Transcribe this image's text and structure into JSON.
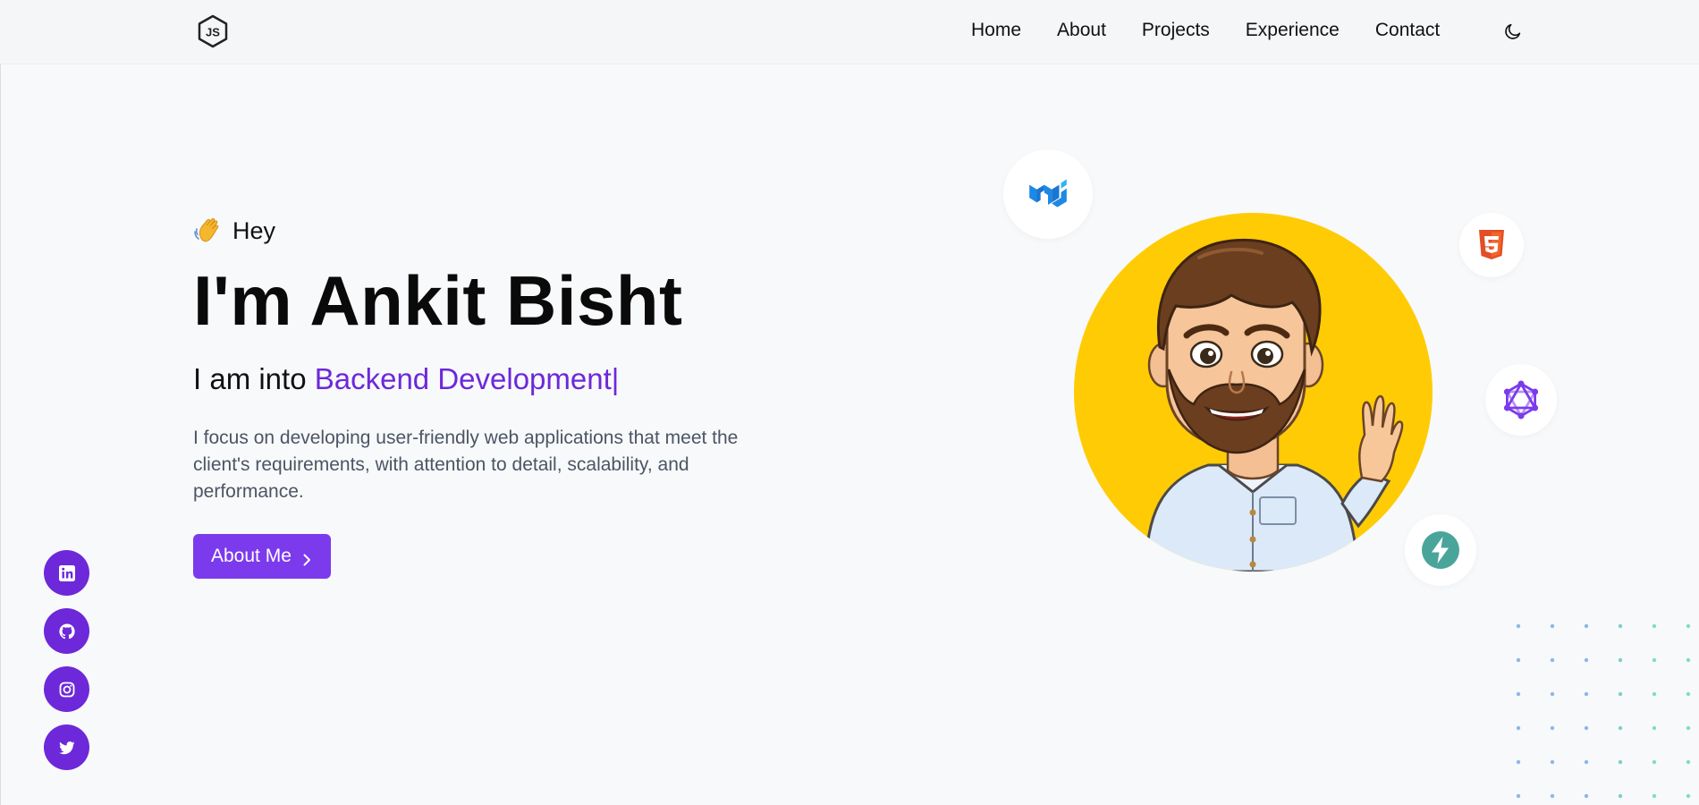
{
  "nav": {
    "logo_icon": "nodejs-hexagon-icon",
    "links": [
      "Home",
      "About",
      "Projects",
      "Experience",
      "Contact"
    ],
    "theme_icon": "moon-icon"
  },
  "hero": {
    "greeting": "Hey",
    "greeting_icon": "waving-hand-icon",
    "name": "I'm Ankit Bisht",
    "tagline_prefix": "I am into",
    "role": "Backend Development",
    "caret": "|",
    "description": "I focus on developing user-friendly web applications that meet the client's requirements, with attention to detail, scalability, and performance.",
    "cta_label": "About Me"
  },
  "social": [
    "linkedin-icon",
    "github-icon",
    "instagram-icon",
    "twitter-icon"
  ],
  "tech_badges": [
    "material-ui-icon",
    "html5-icon",
    "graphql-icon",
    "fastapi-icon"
  ],
  "colors": {
    "accent": "#7c3aed",
    "role_text": "#6d28d9",
    "avatar_bg": "#ffcb05",
    "background": "#f8f9fb"
  }
}
